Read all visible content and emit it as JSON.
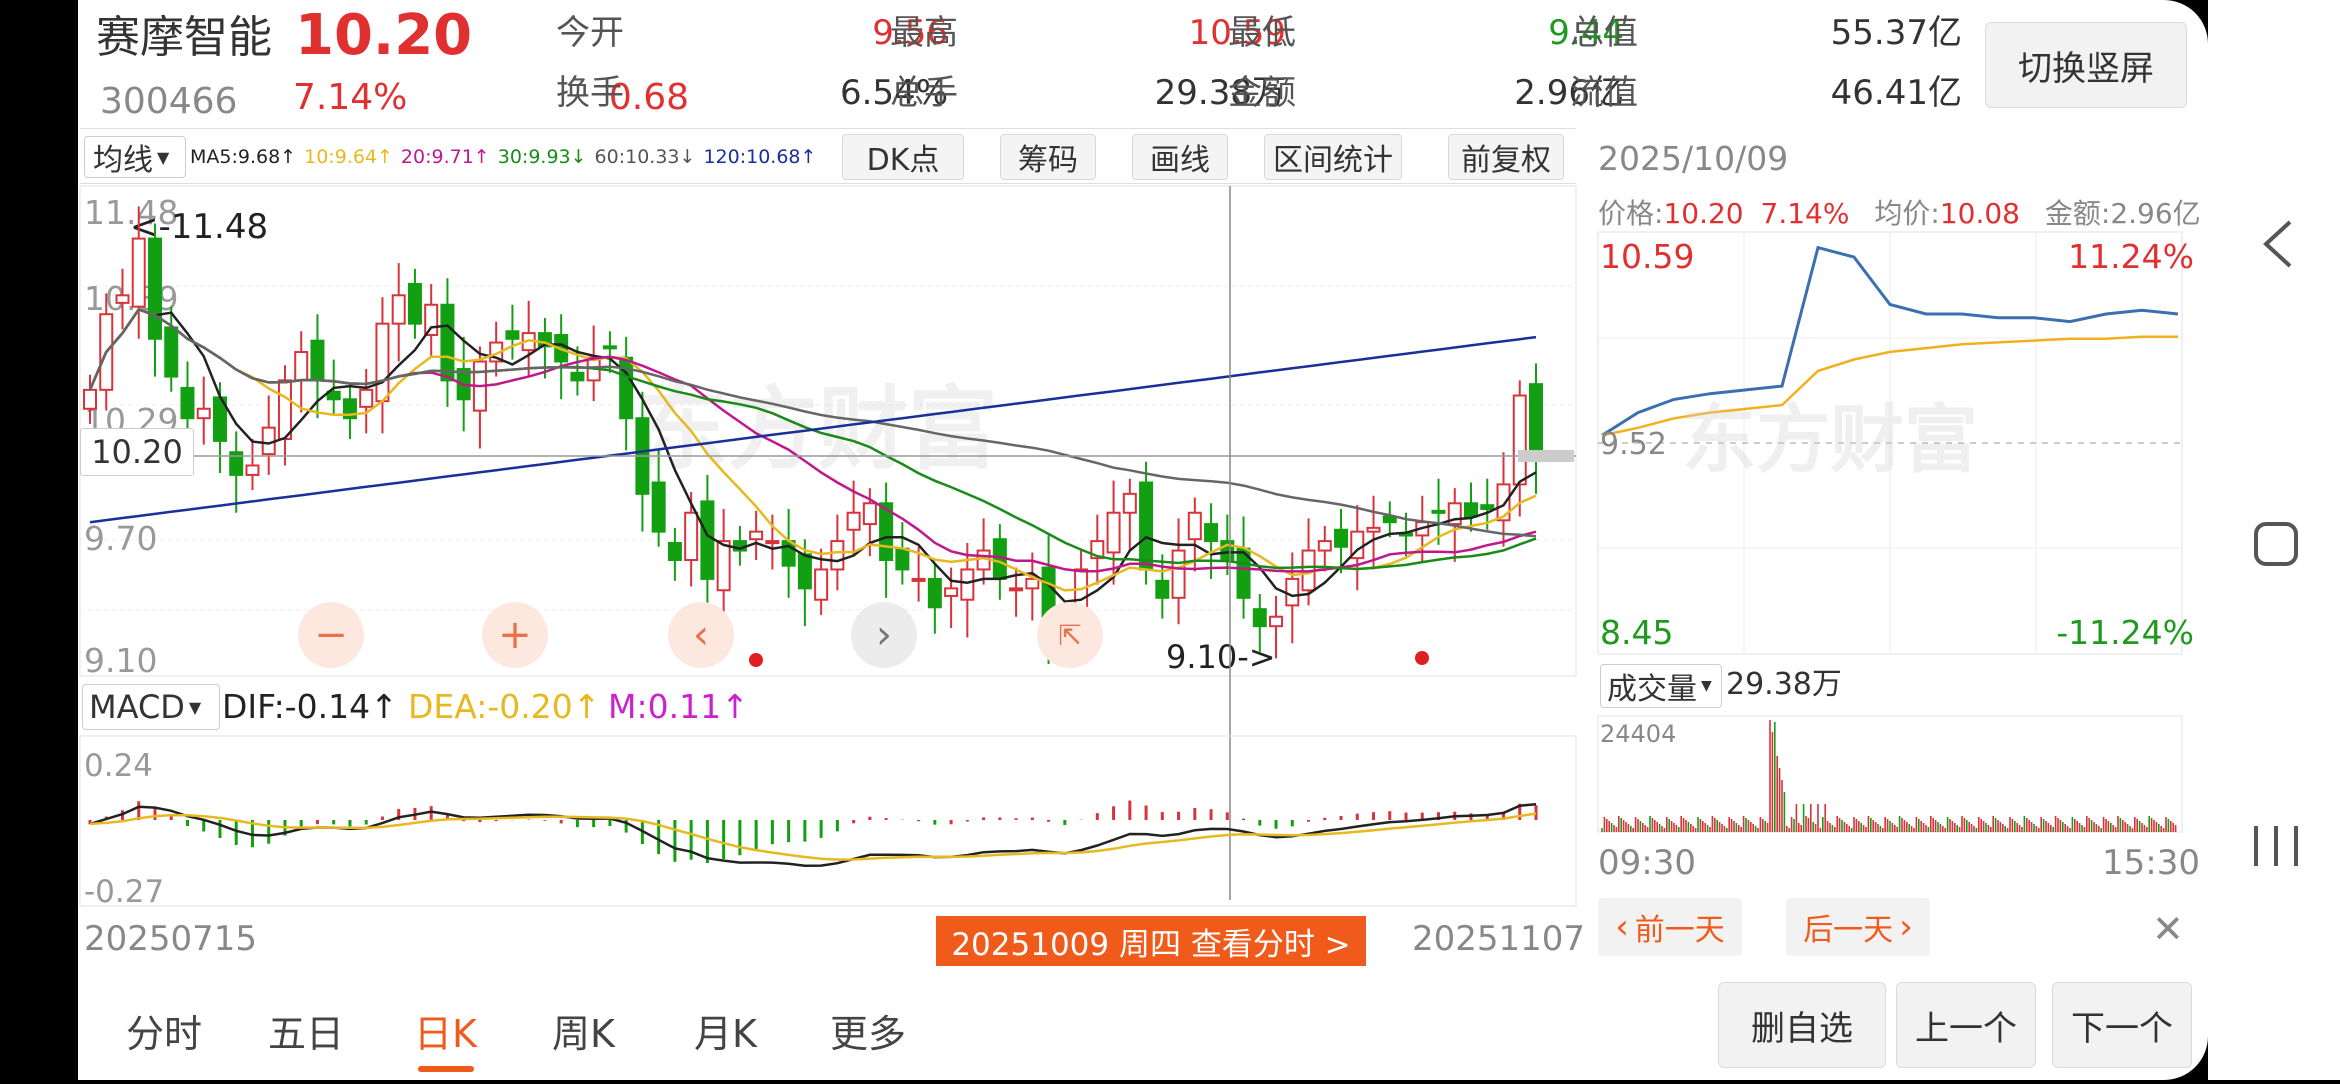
{
  "header": {
    "stock_name": "赛摩智能",
    "price": "10.20",
    "code": "300466",
    "change_pct": "7.14%",
    "change_amt": "0.68",
    "stats": [
      {
        "label": "今开",
        "value": "9.56",
        "color": "red"
      },
      {
        "label": "最高",
        "value": "10.59",
        "color": "red"
      },
      {
        "label": "最低",
        "value": "9.44",
        "color": "green"
      },
      {
        "label": "总值",
        "value": "55.37亿",
        "color": "dark"
      },
      {
        "label": "换手",
        "value": "6.54%",
        "color": "dark"
      },
      {
        "label": "总手",
        "value": "29.38万",
        "color": "dark"
      },
      {
        "label": "金额",
        "value": "2.96亿",
        "color": "dark"
      },
      {
        "label": "流值",
        "value": "46.41亿",
        "color": "dark"
      }
    ],
    "switch_button": "切换竖屏"
  },
  "kline": {
    "ma_selector": "均线",
    "ma_legend": [
      {
        "text": "MA5:9.68↑",
        "color": "#222222"
      },
      {
        "text": "10:9.64↑",
        "color": "#e8b820"
      },
      {
        "text": "20:9.71↑",
        "color": "#c0188a"
      },
      {
        "text": "30:9.93↓",
        "color": "#1a8a1a"
      },
      {
        "text": "60:10.33↓",
        "color": "#555555"
      },
      {
        "text": "120:10.68↑",
        "color": "#1a2f9a"
      }
    ],
    "tool_buttons": [
      "DK点",
      "筹码",
      "画线",
      "区间统计",
      "前复权"
    ],
    "price_labels": [
      "11.48",
      "10.89",
      "10.29",
      "9.70",
      "9.10"
    ],
    "high_marker": "<-11.48",
    "low_marker": "9.10->",
    "current_price_tag": "10.20",
    "start_date": "20250715",
    "end_date": "20251107",
    "selected_date_bar": "20251009 周四 查看分时 >",
    "watermark": "东方财富"
  },
  "macd": {
    "selector": "MACD",
    "dif": "DIF:-0.14↑",
    "dea": "DEA:-0.20↑",
    "m": "M:0.11↑",
    "top_label": "0.24",
    "bottom_label": "-0.27",
    "colors": {
      "dif": "#222222",
      "dea": "#e8b820",
      "m": "#cc22cc"
    }
  },
  "intraday": {
    "date": "2025/10/09",
    "price_label": "价格:",
    "price": "10.20",
    "pct": "7.14%",
    "avg_label": "均价:",
    "avg": "10.08",
    "amount_label": "金额:",
    "amount": "2.96亿",
    "high": "10.59",
    "high_pct": "11.24%",
    "low": "8.45",
    "low_pct": "-11.24%",
    "prev_close": "9.52",
    "volume_selector": "成交量",
    "volume": "29.38万",
    "volume_max": "24404",
    "time_start": "09:30",
    "time_end": "15:30",
    "prev_day": "前一天",
    "next_day": "后一天",
    "watermark": "东方财富"
  },
  "period_tabs": [
    "分时",
    "五日",
    "日K",
    "周K",
    "月K",
    "更多"
  ],
  "active_tab": "日K",
  "bottom_buttons": [
    "删自选",
    "上一个",
    "下一个"
  ],
  "colors": {
    "up": "#e03030",
    "down": "#1f9a1f",
    "accent": "#f05a1a",
    "primary": "#3a6fb0"
  },
  "chart_data": [
    {
      "type": "candlestick",
      "title": "",
      "xlabel": "",
      "ylabel": "",
      "x_range": [
        "20250715",
        "20251107"
      ],
      "ylim": [
        9.1,
        11.48
      ],
      "close_series": [
        10.55,
        10.95,
        11.05,
        11.35,
        10.82,
        10.62,
        10.4,
        10.45,
        10.28,
        10.1,
        10.15,
        10.35,
        10.6,
        10.75,
        10.6,
        10.5,
        10.4,
        10.55,
        10.9,
        11.05,
        10.9,
        11.0,
        10.6,
        10.5,
        10.7,
        10.8,
        10.82,
        10.85,
        10.78,
        10.7,
        10.6,
        10.72,
        10.78,
        10.4,
        10.0,
        9.8,
        9.65,
        9.9,
        9.55,
        9.75,
        9.7,
        9.8,
        9.75,
        9.62,
        9.5,
        9.6,
        9.75,
        9.9,
        9.95,
        9.65,
        9.6,
        9.55,
        9.4,
        9.5,
        9.6,
        9.7,
        9.55,
        9.5,
        9.55,
        9.3,
        9.25,
        9.6,
        9.75,
        9.9,
        10.0,
        9.6,
        9.45,
        9.7,
        9.9,
        9.75,
        9.65,
        9.45,
        9.3,
        9.35,
        9.55,
        9.7,
        9.75,
        9.72,
        9.8,
        9.82,
        9.85,
        9.78,
        9.85,
        9.9,
        9.95,
        9.88,
        9.92,
        10.05,
        10.52,
        10.2
      ],
      "ma_lines": [
        "MA5",
        "MA10",
        "MA20",
        "MA30",
        "MA60",
        "MA120"
      ]
    },
    {
      "type": "bar",
      "title": "MACD",
      "ylim": [
        -0.27,
        0.24
      ],
      "series": [
        {
          "name": "DIF",
          "last": -0.14
        },
        {
          "name": "DEA",
          "last": -0.2
        },
        {
          "name": "M",
          "last": 0.11
        }
      ]
    },
    {
      "type": "line",
      "title": "",
      "ylim": [
        8.45,
        10.59
      ],
      "x": [
        "09:30",
        "15:30"
      ],
      "series": [
        {
          "name": "",
          "values": [
            9.56,
            9.68,
            9.75,
            9.78,
            9.8,
            9.82,
            10.55,
            10.5,
            10.25,
            10.2,
            10.2,
            10.18,
            10.18,
            10.16,
            10.2,
            10.22,
            10.2
          ]
        },
        {
          "name": "",
          "values": [
            9.56,
            9.6,
            9.65,
            9.68,
            9.7,
            9.72,
            9.9,
            9.96,
            10.0,
            10.02,
            10.04,
            10.05,
            10.06,
            10.07,
            10.07,
            10.08,
            10.08
          ]
        }
      ]
    }
  ]
}
